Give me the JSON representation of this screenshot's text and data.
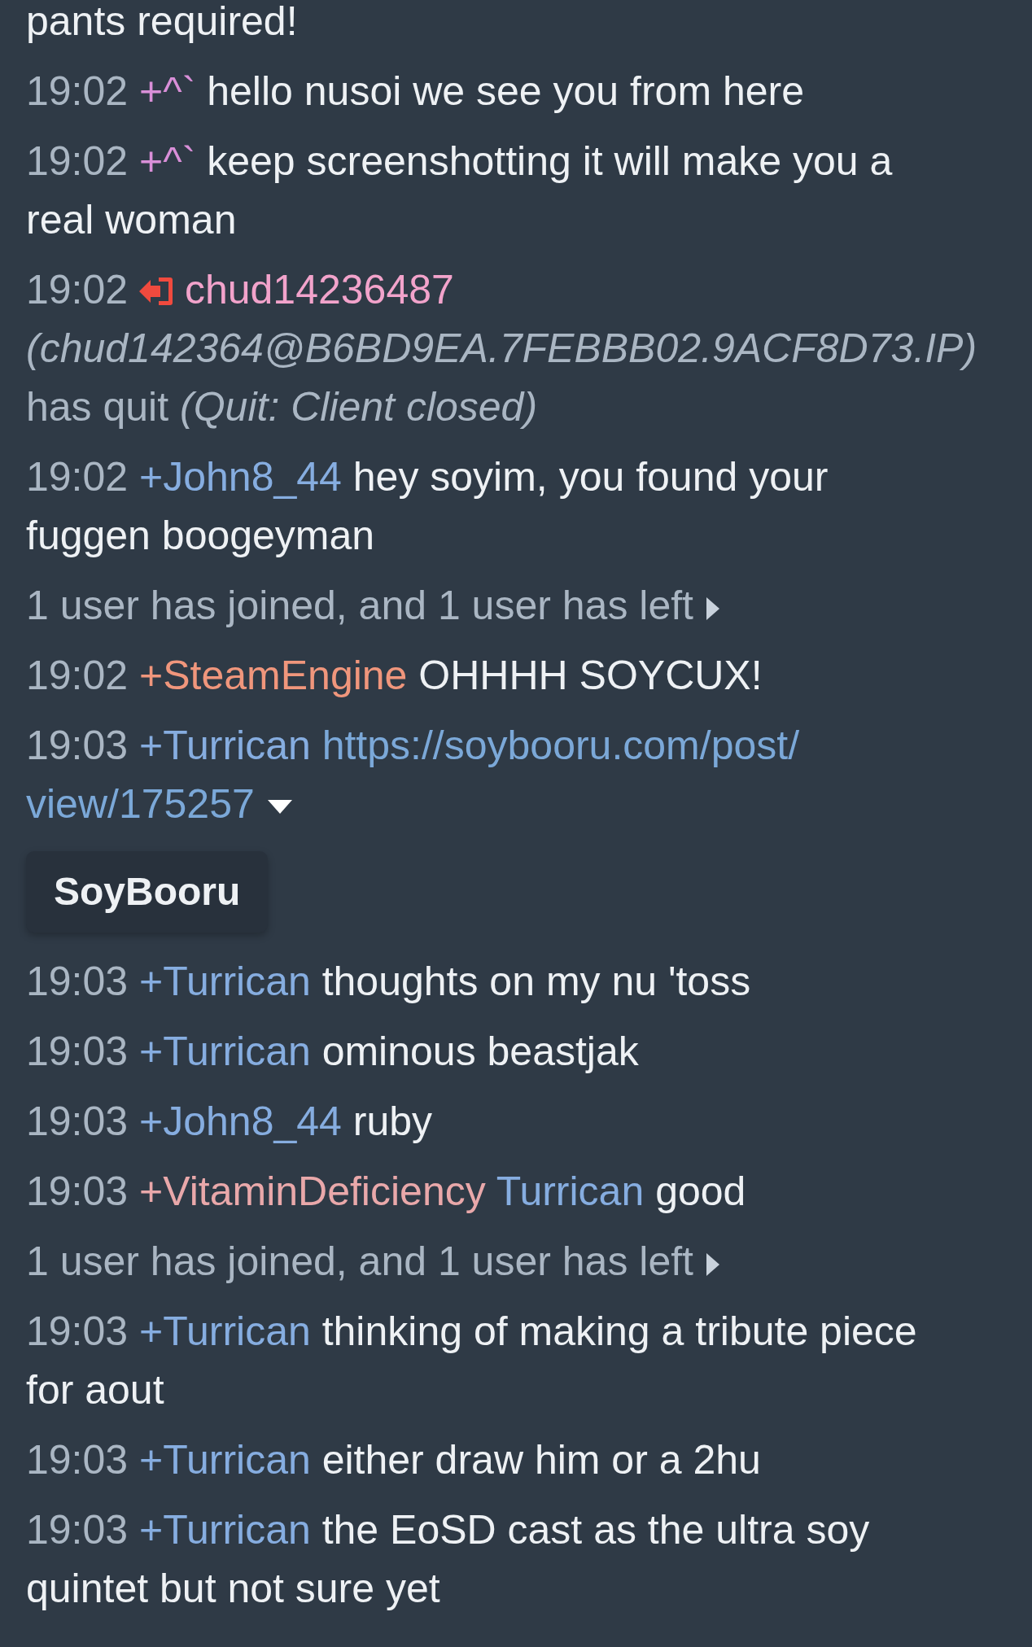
{
  "messages": [
    {
      "kind": "partial",
      "text": [
        "pants required!"
      ]
    },
    {
      "kind": "message",
      "time": "19:02",
      "nick": "+^`",
      "color": "#d98fd8",
      "text": [
        "hello nusoi we see you from here"
      ]
    },
    {
      "kind": "message",
      "time": "19:02",
      "nick": "+^`",
      "color": "#d98fd8",
      "text": [
        "keep screenshotting it will make you a",
        "real woman"
      ]
    },
    {
      "kind": "quit",
      "time": "19:02",
      "nick": "chud14236487",
      "color": "#f2a3cb",
      "host": "(chud142364@B6BD9EA.7FEBBB02.9ACF8D73.IP)",
      "action": "has quit",
      "reason": "(Quit: Client closed)"
    },
    {
      "kind": "message",
      "time": "19:02",
      "nick": "+John8_44",
      "color": "#86ade0",
      "text": [
        "hey soyim, you found your",
        "fuggen boogeyman"
      ]
    },
    {
      "kind": "summary",
      "text": "1 user has joined, and 1 user has left",
      "expanded": false
    },
    {
      "kind": "message",
      "time": "19:02",
      "nick": "+SteamEngine",
      "color": "#f0967c",
      "text": [
        "OHHHH SOYCUX!"
      ]
    },
    {
      "kind": "link",
      "time": "19:03",
      "nick": "+Turrican",
      "color": "#86ade0",
      "link": [
        "https://soybooru.com/post/",
        "view/175257"
      ],
      "expanded": true,
      "preview": {
        "title": "SoyBooru"
      }
    },
    {
      "kind": "message",
      "time": "19:03",
      "nick": "+Turrican",
      "color": "#86ade0",
      "text": [
        "thoughts on my nu 'toss"
      ]
    },
    {
      "kind": "message",
      "time": "19:03",
      "nick": "+Turrican",
      "color": "#86ade0",
      "text": [
        "ominous beastjak"
      ]
    },
    {
      "kind": "message",
      "time": "19:03",
      "nick": "+John8_44",
      "color": "#86ade0",
      "text": [
        "ruby"
      ]
    },
    {
      "kind": "message",
      "time": "19:03",
      "nick": "+VitaminDeficiency",
      "color": "#e9a8aa",
      "mention": {
        "text": "Turrican",
        "color": "#86ade0"
      },
      "text": [
        "good"
      ]
    },
    {
      "kind": "summary",
      "text": "1 user has joined, and 1 user has left",
      "expanded": false
    },
    {
      "kind": "message",
      "time": "19:03",
      "nick": "+Turrican",
      "color": "#86ade0",
      "text": [
        "thinking of making a tribute piece",
        "for aout"
      ]
    },
    {
      "kind": "message",
      "time": "19:03",
      "nick": "+Turrican",
      "color": "#86ade0",
      "text": [
        "either draw him or a 2hu"
      ]
    },
    {
      "kind": "message",
      "time": "19:03",
      "nick": "+Turrican",
      "color": "#86ade0",
      "text": [
        "the EoSD cast as the ultra soy",
        "quintet but not sure yet"
      ]
    }
  ]
}
